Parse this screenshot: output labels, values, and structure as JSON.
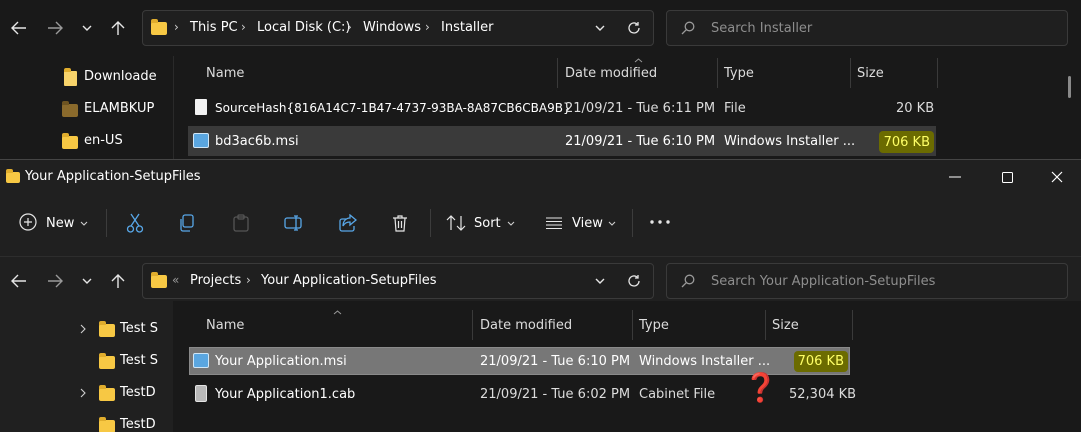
{
  "back_window": {
    "address": {
      "crumbs": [
        "This PC",
        "Local Disk (C:)",
        "Windows",
        "Installer"
      ]
    },
    "search_placeholder": "Search Installer",
    "nav_items": [
      "Downloade",
      "ELAMBKUP",
      "en-US"
    ],
    "columns": {
      "name": "Name",
      "date": "Date modified",
      "type": "Type",
      "size": "Size"
    },
    "rows": [
      {
        "name": "SourceHash{816A14C7-1B47-4737-93BA-8A87CB6CBA9B}",
        "date": "21/09/21 - Tue 6:11 PM",
        "type": "File",
        "size": "20 KB"
      },
      {
        "name": "bd3ac6b.msi",
        "date": "21/09/21 - Tue 6:10 PM",
        "type": "Windows Installer ...",
        "size": "706 KB"
      }
    ]
  },
  "front_window": {
    "title": "Your Application-SetupFiles",
    "toolbar": {
      "new_label": "New",
      "sort_label": "Sort",
      "view_label": "View"
    },
    "address": {
      "overflow": "«",
      "crumbs": [
        "Projects",
        "Your Application-SetupFiles"
      ]
    },
    "search_placeholder": "Search Your Application-SetupFiles",
    "nav_items": [
      "Test S",
      "Test S",
      "TestD",
      "TestD"
    ],
    "columns": {
      "name": "Name",
      "date": "Date modified",
      "type": "Type",
      "size": "Size"
    },
    "rows": [
      {
        "name": "Your Application.msi",
        "date": "21/09/21 - Tue 6:10 PM",
        "type": "Windows Installer ...",
        "size": "706 KB"
      },
      {
        "name": "Your Application1.cab",
        "date": "21/09/21 - Tue 6:02 PM",
        "type": "Cabinet File",
        "size": "52,304 KB"
      }
    ],
    "annotation": "❓"
  },
  "colors": {
    "highlight_bg": "#6b6b00",
    "highlight_text": "#ffff66",
    "folder": "#f7c844",
    "question_mark": "#e0282f"
  }
}
